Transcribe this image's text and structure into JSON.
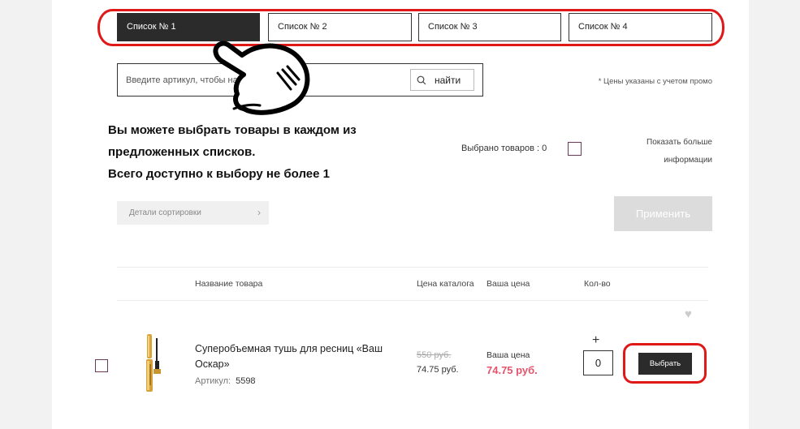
{
  "tabs": [
    {
      "label": "Список № 1",
      "active": true
    },
    {
      "label": "Список № 2",
      "active": false
    },
    {
      "label": "Список № 3",
      "active": false
    },
    {
      "label": "Список № 4",
      "active": false
    }
  ],
  "search": {
    "placeholder": "Введите артикул, чтобы найти",
    "button_label": "найти",
    "icon": "search-icon"
  },
  "price_note": "* Цены указаны с учетом промо",
  "info": {
    "line1": "Вы можете выбрать товары в каждом из",
    "line2": "предложенных списков.",
    "line3": "Всего доступно к выбору не более 1"
  },
  "selected": {
    "label": "Выбрано товаров : 0"
  },
  "more_info": {
    "line1": "Показать больше",
    "line2": "информации"
  },
  "sort_label": "Детали сортировки",
  "apply_label": "Применить",
  "table": {
    "headers": {
      "name": "Название товара",
      "catalog_price": "Цена каталога",
      "your_price": "Ваша цена",
      "qty": "Кол-во"
    },
    "rows": [
      {
        "name": "Суперобъемная тушь для ресниц «Ваш Оскар»",
        "sku_label": "Артикул:",
        "sku": "5598",
        "old_price": "550 руб.",
        "catalog_price": "74.75 руб.",
        "your_price_label": "Ваша цена",
        "your_price": "74.75 руб.",
        "qty": "0",
        "plus": "+",
        "choose_label": "Выбрать"
      }
    ]
  },
  "colors": {
    "accent_red": "#e01818",
    "price_pink": "#e8536c",
    "dark": "#2b2b2b"
  }
}
